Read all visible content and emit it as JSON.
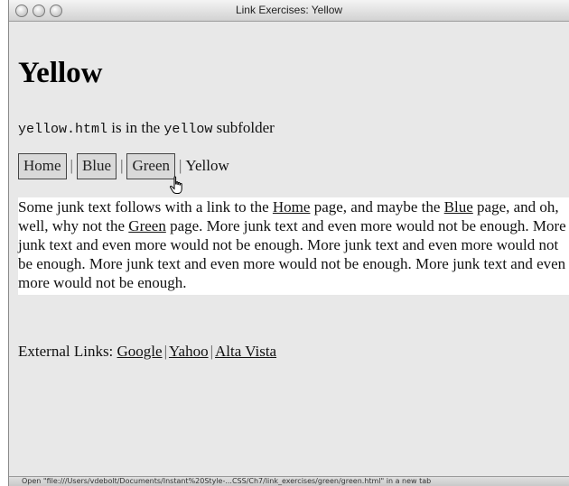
{
  "window": {
    "title": "Link Exercises: Yellow"
  },
  "page": {
    "heading": "Yellow",
    "subtitle": {
      "file": "yellow.html",
      "mid": " is in the ",
      "folder": "yellow",
      "tail": " subfolder"
    },
    "nav": {
      "items": [
        "Home",
        "Blue",
        "Green"
      ],
      "separator": "|",
      "current": "Yellow"
    },
    "paragraph": {
      "t1": "Some junk text follows with a link to the ",
      "link_home": "Home",
      "t2": " page, and maybe the ",
      "link_blue": "Blue",
      "t3": " page, and oh, well, why not the ",
      "link_green": "Green",
      "t4": " page. More junk text and even more would not be enough. More junk text and even more would not be enough. More junk text and even more would not be enough. More junk text and even more would not be enough. More junk text and even more would not be enough."
    },
    "external": {
      "label": "External Links: ",
      "links": [
        "Google",
        "Yahoo",
        "Alta Vista"
      ],
      "separator": "|"
    }
  },
  "status": {
    "text": "Open \"file:///Users/vdebolt/Documents/Instant%20Style-...CSS/Ch7/link_exercises/green/green.html\" in a new tab"
  }
}
